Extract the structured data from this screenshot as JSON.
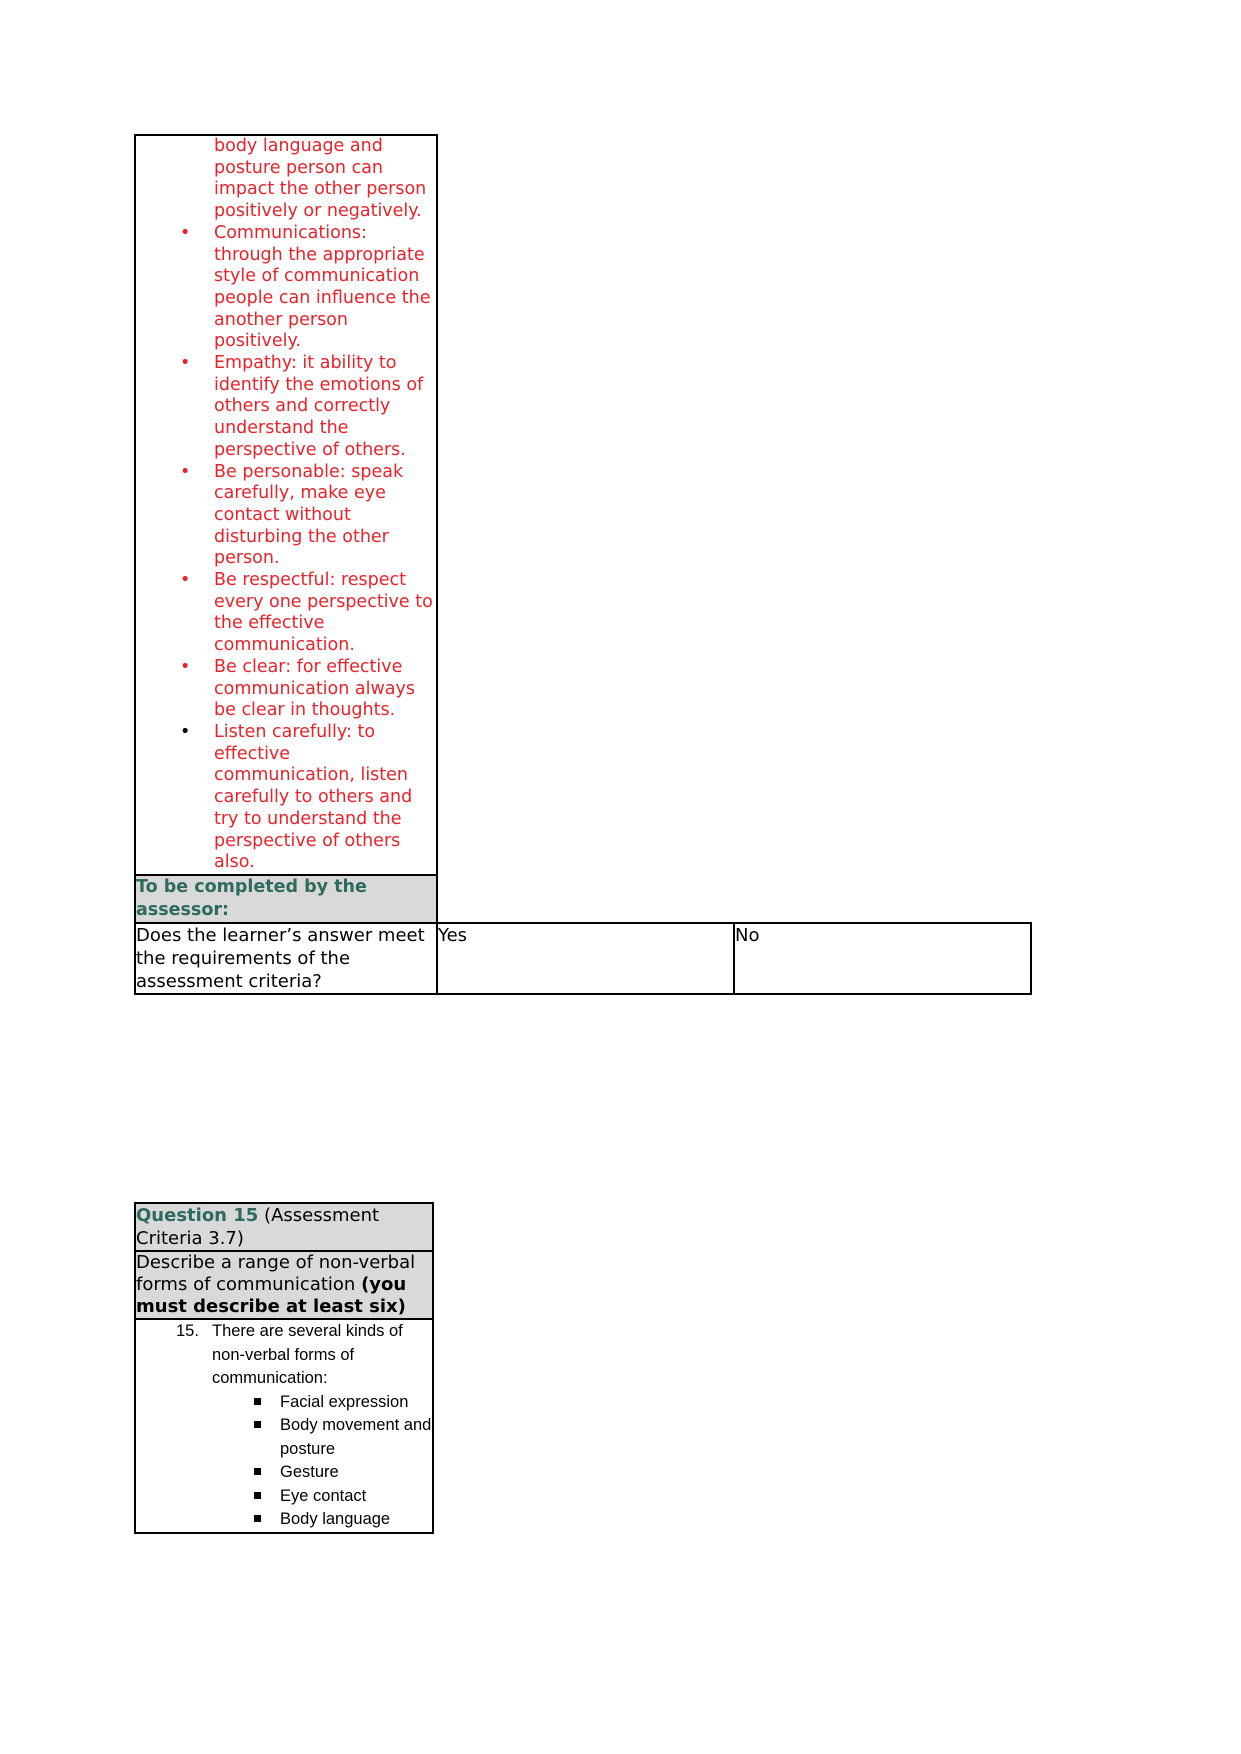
{
  "document": {
    "type": "assessment-workbook-page"
  },
  "colors": {
    "learner_answer_red": "#e8232a",
    "heading_teal": "#2e6b5e",
    "shaded_cell_gray": "#d9d9d9",
    "border_black": "#000000"
  },
  "answer_continuation": {
    "bullets": [
      {
        "marker": "",
        "marker_color": "none",
        "text": "body language and posture person can impact the other person positively or negatively.",
        "continuation": true
      },
      {
        "marker": "•",
        "marker_color": "red",
        "text": "Communications: through the appropriate style of communication people can influence the another person positively.",
        "continuation": false
      },
      {
        "marker": "•",
        "marker_color": "red",
        "text": "Empathy: it ability to identify the emotions of others and correctly understand the perspective of others.",
        "continuation": false
      },
      {
        "marker": "•",
        "marker_color": "red",
        "text": "Be personable: speak carefully, make eye contact without disturbing the other person.",
        "continuation": false
      },
      {
        "marker": "•",
        "marker_color": "red",
        "text": "Be respectful: respect every one perspective to the effective communication.",
        "continuation": false
      },
      {
        "marker": "•",
        "marker_color": "red",
        "text": "Be clear: for effective communication always be clear in thoughts.",
        "continuation": false
      },
      {
        "marker": "•",
        "marker_color": "black",
        "text": "Listen carefully: to effective communication, listen carefully to others and try to understand the perspective of others also.",
        "continuation": false
      }
    ]
  },
  "assessor_section": {
    "heading": "To be completed by the assessor:",
    "question": "Does the learner’s answer meet the requirements of the assessment criteria?",
    "yes_label": "Yes",
    "no_label": "No"
  },
  "question15": {
    "number_label": "Question 15",
    "criteria_label": "(Assessment Criteria 3.7)",
    "prompt_plain": "Describe a range of non-verbal forms of communication ",
    "prompt_bold": "(you must describe at least six)",
    "answer": {
      "item_number": "15.",
      "intro": "There are several kinds of non-verbal forms of communication:",
      "items": [
        "Facial expression",
        "Body movement and posture",
        "Gesture",
        "Eye contact",
        "Body language"
      ]
    }
  }
}
